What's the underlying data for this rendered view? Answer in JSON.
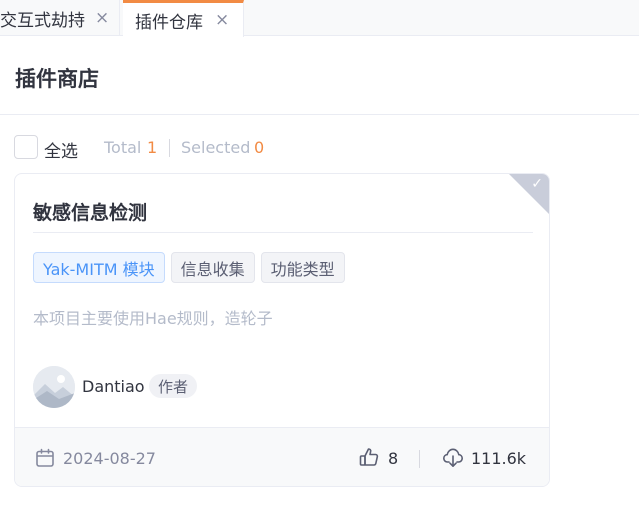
{
  "tabs": [
    {
      "label": "交互式劫持",
      "close": "×",
      "active": false
    },
    {
      "label": "插件仓库",
      "close": "×",
      "active": true
    }
  ],
  "page": {
    "title": "插件商店"
  },
  "selection": {
    "select_all_label": "全选",
    "total_label": "Total",
    "total_count": "1",
    "selected_label": "Selected",
    "selected_count": "0"
  },
  "plugin_card": {
    "title": "敏感信息检测",
    "selected_check": "✓",
    "tags": [
      "Yak-MITM 模块",
      "信息收集",
      "功能类型"
    ],
    "description": "本项目主要使用Hae规则，造轮子",
    "author": "Dantiao",
    "author_badge": "作者",
    "date": "2024-08-27",
    "likes": "8",
    "downloads": "111.6k"
  },
  "icons": {
    "calendar": "calendar-icon",
    "like": "thumbs-up-icon",
    "download": "cloud-download-icon",
    "avatar": "avatar-image"
  },
  "colors": {
    "accent": "#f28b44",
    "tag_primary": "#4a94f8",
    "muted_text": "#b4bbca",
    "text": "#31343f"
  }
}
